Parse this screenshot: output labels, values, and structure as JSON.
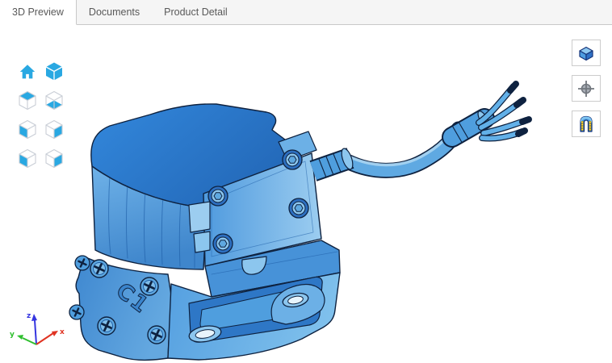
{
  "tabs": [
    {
      "label": "3D Preview",
      "active": true
    },
    {
      "label": "Documents",
      "active": false
    },
    {
      "label": "Product Detail",
      "active": false
    }
  ],
  "viewer": {
    "view_toolbar": [
      {
        "name": "home-view-icon"
      },
      {
        "name": "isometric-view-icon"
      },
      {
        "name": "top-view-icon"
      },
      {
        "name": "bottom-view-icon"
      },
      {
        "name": "left-view-icon"
      },
      {
        "name": "right-view-icon"
      },
      {
        "name": "front-view-icon"
      },
      {
        "name": "back-view-icon"
      }
    ],
    "display_toolbar": [
      {
        "name": "shaded-view-icon"
      },
      {
        "name": "locate-target-icon"
      },
      {
        "name": "section-view-icon"
      }
    ],
    "model": {
      "kind": "solenoid-valve-with-cable",
      "marking": "C1"
    },
    "axis_triad": {
      "x_label": "x",
      "y_label": "y",
      "z_label": "z"
    }
  },
  "colors": {
    "icon_accent": "#29a8e2",
    "model_top_blue": "#2b7cd2",
    "model_mid_blue": "#4d9ade",
    "model_light_blue": "#8cc6ee",
    "model_outline": "#0e2240",
    "axis_x": "#e03322",
    "axis_y": "#2fbf2f",
    "axis_z": "#3535e0",
    "tab_bar_bg": "#f5f5f5",
    "tab_border": "#c9c9c9",
    "tab_text": "#595959",
    "section_icon_yellow": "#ffd43b"
  }
}
